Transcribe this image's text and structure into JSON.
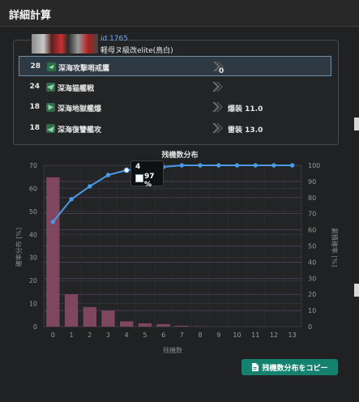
{
  "window": {
    "title": "詳細計算"
  },
  "enemy": {
    "id": "id 1765",
    "name": "軽母ヌ級改elite(鳥白)"
  },
  "equipment": [
    {
      "slot": "28",
      "name": "深海攻撃哨戒鷹",
      "value": "0",
      "selected": true
    },
    {
      "slot": "24",
      "name": "深海猫艦戦",
      "value": "",
      "selected": false
    },
    {
      "slot": "18",
      "name": "深海地獄艦爆",
      "value": "爆装 11.0",
      "selected": false
    },
    {
      "slot": "18",
      "name": "深海復讐艦攻",
      "value": "雷装 13.0",
      "selected": false
    }
  ],
  "tooltip": {
    "label": "4",
    "value": "97 %"
  },
  "copy_button": {
    "label": "残機数分布をコピー",
    "icon": "document-icon"
  },
  "colors": {
    "bar": "#8a4a66",
    "line": "#4a9ae8",
    "accent": "#14826e"
  },
  "chart_data": {
    "type": "bar",
    "title": "残機数分布",
    "xlabel": "残機数",
    "ylabel": "確率分布 [%]",
    "y2label": "累積確率 [%]",
    "categories": [
      "0",
      "1",
      "2",
      "3",
      "4",
      "5",
      "6",
      "7",
      "8",
      "9",
      "10",
      "11",
      "12",
      "13"
    ],
    "ylim": [
      0,
      70
    ],
    "yticks": [
      0,
      10,
      20,
      30,
      40,
      50,
      60,
      70
    ],
    "y2lim": [
      0,
      100
    ],
    "y2ticks": [
      0,
      10,
      20,
      30,
      40,
      50,
      60,
      70,
      80,
      90,
      100
    ],
    "series": [
      {
        "name": "確率分布",
        "type": "bar",
        "values": [
          64.8,
          14.0,
          8.5,
          6.9,
          2.3,
          1.4,
          1.1,
          0.4,
          0.1,
          0,
          0,
          0,
          0,
          0
        ]
      },
      {
        "name": "累積確率",
        "type": "line",
        "axis": "right",
        "values": [
          65,
          79,
          87,
          94,
          97,
          98,
          99,
          100,
          100,
          100,
          100,
          100,
          100,
          100
        ]
      }
    ]
  }
}
